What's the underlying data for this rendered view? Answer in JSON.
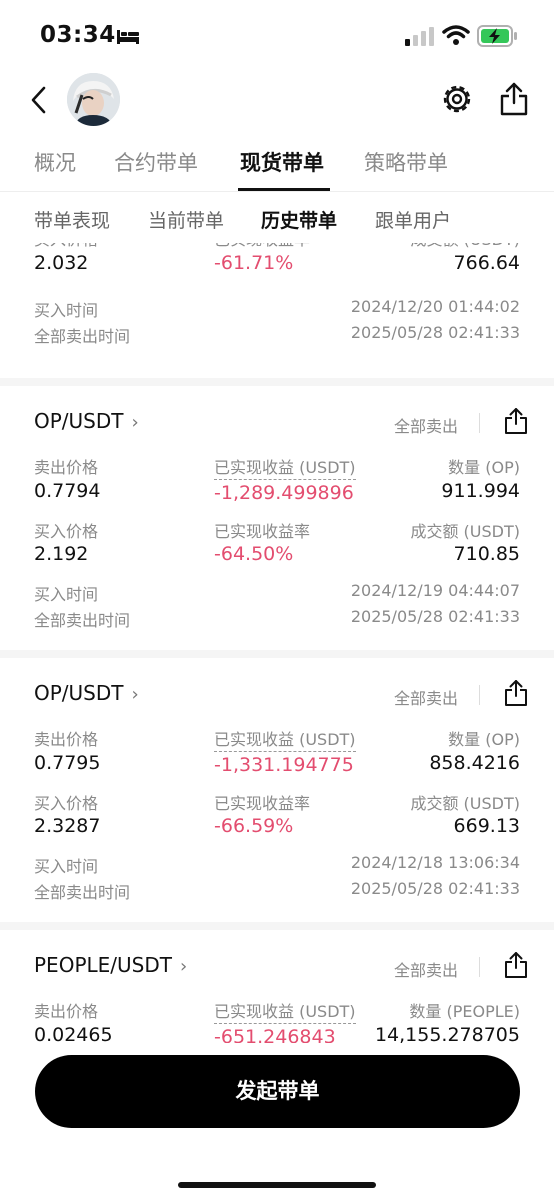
{
  "status_bar": {
    "time": "03:34"
  },
  "main_tabs": [
    {
      "label": "概况",
      "active": false
    },
    {
      "label": "合约带单",
      "active": false
    },
    {
      "label": "现货带单",
      "active": true
    },
    {
      "label": "策略带单",
      "active": false
    }
  ],
  "sub_tabs": [
    {
      "label": "带单表现",
      "active": false
    },
    {
      "label": "当前带单",
      "active": false
    },
    {
      "label": "历史带单",
      "active": true
    },
    {
      "label": "跟单用户",
      "active": false
    }
  ],
  "labels": {
    "sell_price": "卖出价格",
    "realized_pnl": "已实现收益 (USDT)",
    "buy_price": "买入价格",
    "realized_rate": "已实现收益率",
    "turnover": "成交额 (USDT)",
    "buy_time": "买入时间",
    "sell_all_time": "全部卖出时间",
    "sold_all": "全部卖出"
  },
  "cards": [
    {
      "pair": "",
      "sell_price": "",
      "pnl": "",
      "qty_label": "",
      "qty": "",
      "buy_price": "2.032",
      "rate": "-61.71%",
      "turnover": "766.64",
      "buy_time": "2024/12/20 01:44:02",
      "sell_time": "2025/05/28 02:41:33"
    },
    {
      "pair": "OP/USDT",
      "sell_price": "0.7794",
      "pnl": "-1,289.499896",
      "qty_label": "数量 (OP)",
      "qty": "911.994",
      "buy_price": "2.192",
      "rate": "-64.50%",
      "turnover": "710.85",
      "buy_time": "2024/12/19 04:44:07",
      "sell_time": "2025/05/28 02:41:33"
    },
    {
      "pair": "OP/USDT",
      "sell_price": "0.7795",
      "pnl": "-1,331.194775",
      "qty_label": "数量 (OP)",
      "qty": "858.4216",
      "buy_price": "2.3287",
      "rate": "-66.59%",
      "turnover": "669.13",
      "buy_time": "2024/12/18 13:06:34",
      "sell_time": "2025/05/28 02:41:33"
    },
    {
      "pair": "PEOPLE/USDT",
      "sell_price": "0.02465",
      "pnl": "-651.246843",
      "qty_label": "数量 (PEOPLE)",
      "qty": "14,155.278705",
      "buy_price": "",
      "rate": "",
      "turnover": "",
      "buy_time": "",
      "sell_time": ""
    }
  ],
  "primary_button": "发起带单",
  "colors": {
    "loss": "#e34d6f",
    "primary_button_bg": "#000000"
  }
}
